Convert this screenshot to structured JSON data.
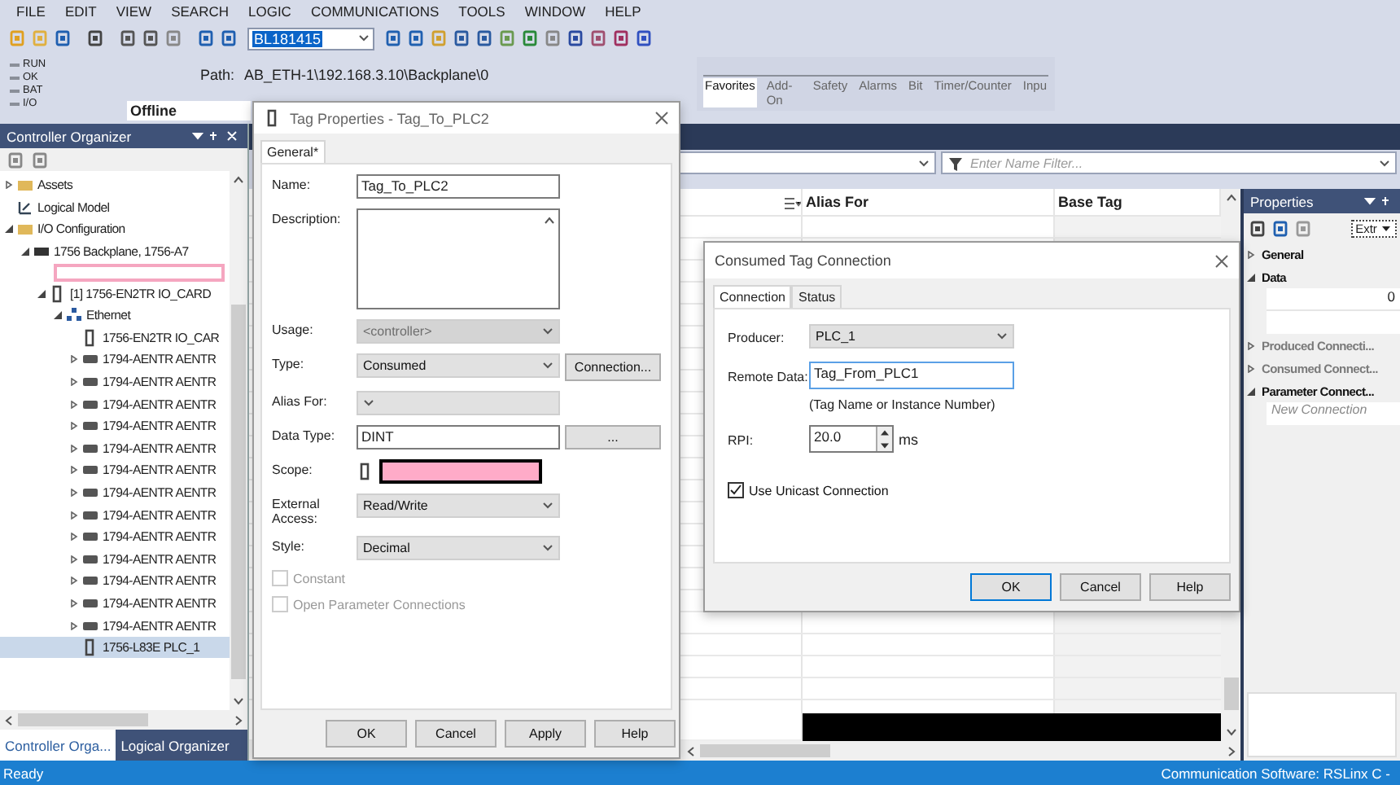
{
  "menu": [
    "FILE",
    "EDIT",
    "VIEW",
    "SEARCH",
    "LOGIC",
    "COMMUNICATIONS",
    "TOOLS",
    "WINDOW",
    "HELP"
  ],
  "toolbar": {
    "search_value": "BL181415"
  },
  "status_indicators": [
    "RUN",
    "OK",
    "BAT",
    "I/O"
  ],
  "path": {
    "label": "Path:",
    "value": "AB_ETH-1\\192.168.3.10\\Backplane\\0"
  },
  "mode": "Offline",
  "instruction_tabs": [
    {
      "label": "Favorites",
      "selected": true
    },
    {
      "label": "Add-On",
      "selected": false
    },
    {
      "label": "Safety",
      "selected": false
    },
    {
      "label": "Alarms",
      "selected": false
    },
    {
      "label": "Bit",
      "selected": false
    },
    {
      "label": "Timer/Counter",
      "selected": false
    },
    {
      "label": "Inpu",
      "selected": false
    }
  ],
  "organizer": {
    "title": "Controller Organizer",
    "tree": [
      {
        "label": "Assets",
        "kind": "folder",
        "expanded": false,
        "selected": false
      },
      {
        "label": "Logical Model",
        "kind": "model",
        "selected": false
      },
      {
        "label": "I/O Configuration",
        "kind": "folder",
        "expanded": true,
        "selected": false,
        "children": [
          {
            "label": "1756 Backplane, 1756-A7",
            "kind": "rack",
            "expanded": true,
            "selected": false,
            "children": [
              {
                "kind": "redacted"
              },
              {
                "label": "[1] 1756-EN2TR IO_CARD",
                "kind": "module",
                "expanded": true,
                "selected": false,
                "children": [
                  {
                    "label": "Ethernet",
                    "kind": "network",
                    "expanded": true,
                    "selected": false,
                    "children": [
                      {
                        "label": "1756-EN2TR IO_CAR",
                        "kind": "module",
                        "selected": false
                      },
                      {
                        "label": "1794-AENTR AENTR",
                        "kind": "adapter",
                        "expanded": false,
                        "selected": false
                      },
                      {
                        "label": "1794-AENTR AENTR",
                        "kind": "adapter",
                        "expanded": false,
                        "selected": false
                      },
                      {
                        "label": "1794-AENTR AENTR",
                        "kind": "adapter",
                        "expanded": false,
                        "selected": false
                      },
                      {
                        "label": "1794-AENTR AENTR",
                        "kind": "adapter",
                        "expanded": false,
                        "selected": false
                      },
                      {
                        "label": "1794-AENTR AENTR",
                        "kind": "adapter",
                        "expanded": false,
                        "selected": false
                      },
                      {
                        "label": "1794-AENTR AENTR",
                        "kind": "adapter",
                        "expanded": false,
                        "selected": false
                      },
                      {
                        "label": "1794-AENTR AENTR",
                        "kind": "adapter",
                        "expanded": false,
                        "selected": false
                      },
                      {
                        "label": "1794-AENTR AENTR",
                        "kind": "adapter",
                        "expanded": false,
                        "selected": false
                      },
                      {
                        "label": "1794-AENTR AENTR",
                        "kind": "adapter",
                        "expanded": false,
                        "selected": false
                      },
                      {
                        "label": "1794-AENTR AENTR",
                        "kind": "adapter",
                        "expanded": false,
                        "selected": false
                      },
                      {
                        "label": "1794-AENTR AENTR",
                        "kind": "adapter",
                        "expanded": false,
                        "selected": false
                      },
                      {
                        "label": "1794-AENTR AENTR",
                        "kind": "adapter",
                        "expanded": false,
                        "selected": false
                      },
                      {
                        "label": "1794-AENTR AENTR",
                        "kind": "adapter",
                        "expanded": false,
                        "selected": false
                      },
                      {
                        "label": "1756-L83E PLC_1",
                        "kind": "module",
                        "selected": true
                      }
                    ]
                  }
                ]
              }
            ]
          }
        ]
      }
    ],
    "tabs": [
      {
        "label": "Controller Orga...",
        "selected": true
      },
      {
        "label": "Logical Organizer",
        "selected": false
      }
    ]
  },
  "tag_editor": {
    "filter_placeholder": "Enter Name Filter...",
    "columns": [
      "Alias For",
      "Base Tag"
    ]
  },
  "properties": {
    "title": "Properties",
    "sort_value": "Extr",
    "sections": [
      {
        "label": "General",
        "expanded": false,
        "disabled": false
      },
      {
        "label": "Data",
        "expanded": true,
        "disabled": false,
        "rows": [
          {
            "value": "0"
          }
        ]
      },
      {
        "label": "Produced Connecti...",
        "expanded": false,
        "disabled": true
      },
      {
        "label": "Consumed Connect...",
        "expanded": false,
        "disabled": true
      },
      {
        "label": "Parameter Connect...",
        "expanded": true,
        "disabled": false,
        "rows": [
          {
            "placeholder": "New Connection"
          }
        ]
      }
    ]
  },
  "tag_dialog": {
    "title": "Tag Properties - Tag_To_PLC2",
    "tabs": [
      {
        "label": "General*",
        "selected": true
      }
    ],
    "fields": [
      {
        "kind": "text",
        "label": "Name:",
        "value": "Tag_To_PLC2"
      },
      {
        "kind": "textarea",
        "label": "Description:"
      },
      {
        "kind": "select",
        "label": "Usage:",
        "value": "<controller>",
        "disabled": true
      },
      {
        "kind": "select",
        "label": "Type:",
        "value": "Consumed",
        "disabled": false,
        "button": "Connection..."
      },
      {
        "kind": "select",
        "label": "Alias For:",
        "disabled": false
      },
      {
        "kind": "text",
        "label": "Data Type:",
        "value": "DINT",
        "button": "..."
      },
      {
        "kind": "redacted",
        "label": "Scope:"
      },
      {
        "kind": "select",
        "label": "External Access:",
        "value": "Read/Write",
        "disabled": false
      },
      {
        "kind": "select",
        "label": "Style:",
        "value": "Decimal",
        "disabled": false
      }
    ],
    "checkboxes": [
      {
        "label": "Constant",
        "checked": false,
        "disabled": true
      },
      {
        "label": "Open Parameter Connections",
        "checked": false,
        "disabled": true
      }
    ],
    "buttons": [
      "OK",
      "Cancel",
      "Apply",
      "Help"
    ]
  },
  "connection_dialog": {
    "title": "Consumed Tag Connection",
    "tabs": [
      {
        "label": "Connection",
        "selected": true
      },
      {
        "label": "Status",
        "selected": false
      }
    ],
    "producer": {
      "label": "Producer:",
      "value": "PLC_1"
    },
    "remote_data": {
      "label": "Remote Data:",
      "value": "Tag_From_PLC1",
      "hint": "(Tag Name or Instance Number)"
    },
    "rpi": {
      "label": "RPI:",
      "value": "20.0",
      "unit": "ms"
    },
    "unicast": {
      "label": "Use Unicast Connection",
      "checked": true
    },
    "buttons": [
      {
        "label": "OK",
        "default": true
      },
      {
        "label": "Cancel",
        "default": false
      },
      {
        "label": "Help",
        "default": false
      }
    ]
  },
  "status_bar": {
    "left": "Ready",
    "right": "Communication Software: RSLinx C -"
  }
}
